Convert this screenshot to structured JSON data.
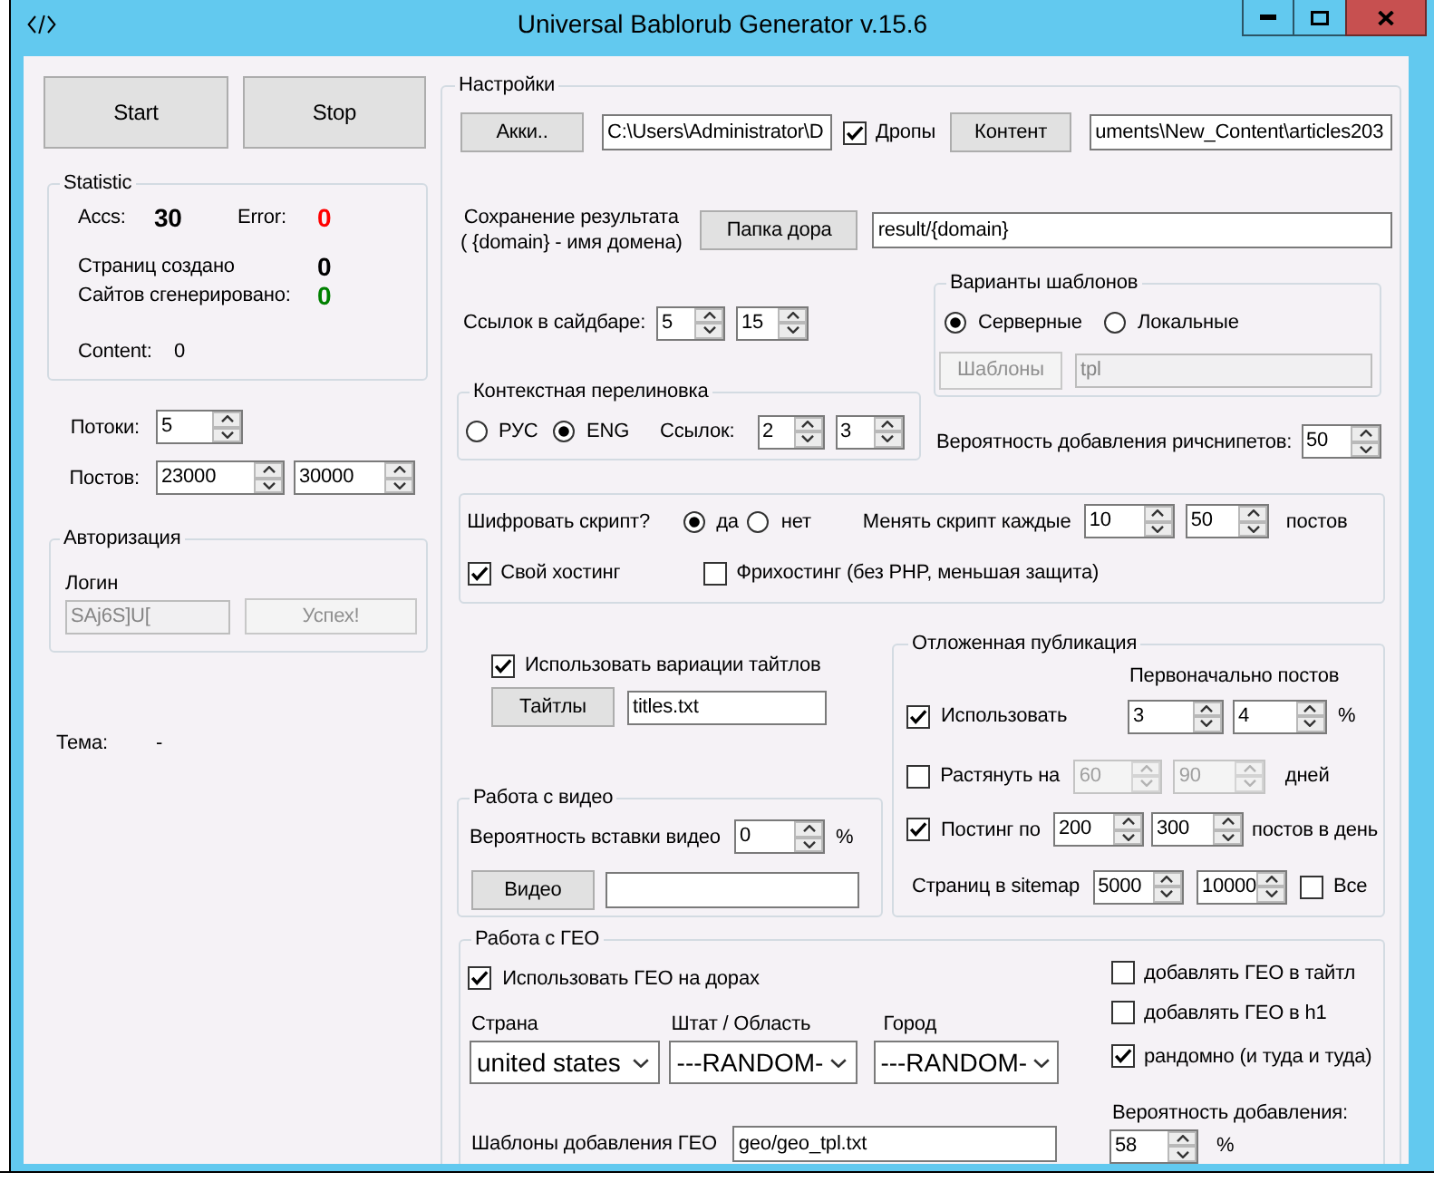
{
  "window": {
    "title": "Universal Bablorub Generator v.15.6"
  },
  "left": {
    "buttons": [
      {
        "label": "Start"
      },
      {
        "label": "Stop"
      }
    ],
    "statistic": {
      "title": "Statistic",
      "stats": [
        {
          "label": "Accs:",
          "value": "30",
          "color": "#000000"
        },
        {
          "label": "Error:",
          "value": "0",
          "color": "#ff0000"
        },
        {
          "label": "Страниц создано",
          "value": "0",
          "color": "#000000"
        },
        {
          "label": "Сайтов сгенерировано:",
          "value": "0",
          "color": "#008000"
        }
      ],
      "content": {
        "label": "Content:",
        "value": "0"
      }
    },
    "threads": {
      "label": "Потоки:",
      "spinners": [
        "5"
      ]
    },
    "posts": {
      "label": "Постов:",
      "spinners": [
        "23000",
        "30000"
      ]
    },
    "auth": {
      "title": "Авторизация",
      "label": "Логин",
      "login": {
        "value": "SAj6S]U[",
        "disabled": true
      },
      "button": {
        "label": "Успех!",
        "disabled": true
      }
    },
    "theme": {
      "label": "Тема:",
      "value": "-"
    }
  },
  "settings": {
    "title": "Настройки",
    "accounts": {
      "button": "Акки..",
      "path": "C:\\Users\\Administrator\\D"
    },
    "drops": {
      "label": "Дропы",
      "checked": true
    },
    "content": {
      "button": "Контент",
      "path": "uments\\New_Content\\articles203"
    },
    "result": {
      "label": "Сохранение результата\n( {domain} - имя домена)",
      "button": "Папка дора",
      "path": "result/{domain}"
    },
    "sidebar_links": {
      "label": "Ссылок в сайдбаре:",
      "spinners": [
        "5",
        "15"
      ]
    },
    "templates": {
      "title": "Варианты шаблонов",
      "options": [
        {
          "label": "Серверные",
          "selected": true
        },
        {
          "label": "Локальные",
          "selected": false
        }
      ],
      "button": {
        "label": "Шаблоны",
        "disabled": true
      },
      "field": {
        "value": "tpl",
        "disabled": true
      }
    },
    "context_links": {
      "title": "Контекстная перелиновка",
      "options": [
        {
          "label": "РУС",
          "selected": false
        },
        {
          "label": "ENG",
          "selected": true
        }
      ],
      "label": "Ссылок:",
      "spinners": [
        "2",
        "3"
      ]
    },
    "richsnippets": {
      "label": "Вероятность добавления ричснипетов:",
      "spinners": [
        "50"
      ]
    },
    "script": {
      "label": "Шифровать скрипт?",
      "options": [
        {
          "label": "да",
          "selected": true
        },
        {
          "label": "нет",
          "selected": false
        }
      ],
      "change_label": "Менять скрипт каждые",
      "spinners": [
        "10",
        "50"
      ],
      "unit": "постов",
      "hosting": [
        {
          "label": "Свой хостинг",
          "checked": true
        },
        {
          "label": "Фрихостинг (без PHP, меньшая защита)",
          "checked": false
        }
      ]
    },
    "titles": {
      "label": "Использовать вариации тайтлов",
      "checked": true,
      "button": "Тайтлы",
      "path": "titles.txt"
    },
    "video": {
      "title": "Работа с видео",
      "label": "Вероятность вставки видео",
      "spinners": [
        "0"
      ],
      "unit": "%",
      "button": "Видео"
    },
    "delayed": {
      "title": "Отложенная публикация",
      "header": "Первоначально постов",
      "rows": [
        {
          "kind": "check",
          "label": "Использовать",
          "checked": true,
          "disabled": false,
          "spinners": [
            "3",
            "4"
          ],
          "unit": "%"
        },
        {
          "kind": "check",
          "label": "Растянуть на",
          "checked": false,
          "disabled": true,
          "spinners": [
            "60",
            "90"
          ],
          "unit": "дней"
        },
        {
          "kind": "check",
          "label": "Постинг по",
          "checked": true,
          "disabled": false,
          "spinners": [
            "200",
            "300"
          ],
          "unit": "постов в день"
        },
        {
          "kind": "plain",
          "label": "Страниц в sitemap",
          "disabled": false,
          "spinners": [
            "5000",
            "10000"
          ],
          "option": {
            "label": "Все",
            "checked": false
          }
        }
      ]
    },
    "geo": {
      "title": "Работа с ГЕО",
      "use": {
        "label": "Использовать ГЕО на дорах",
        "checked": true
      },
      "selects": [
        {
          "label": "Страна",
          "value": "united states"
        },
        {
          "label": "Штат / Область",
          "value": "---RANDOM-"
        },
        {
          "label": "Город",
          "value": "---RANDOM-"
        }
      ],
      "options": [
        {
          "label": "добавлять ГЕО в тайтл",
          "checked": false
        },
        {
          "label": "добавлять ГЕО в h1",
          "checked": false
        },
        {
          "label": "рандомно (и туда и туда)",
          "checked": true
        }
      ],
      "probability": {
        "label": "Вероятность добавления:",
        "spinners": [
          "58"
        ],
        "unit": "%"
      },
      "templates": {
        "label": "Шаблоны добавления ГЕО",
        "path": "geo/geo_tpl.txt"
      }
    }
  }
}
